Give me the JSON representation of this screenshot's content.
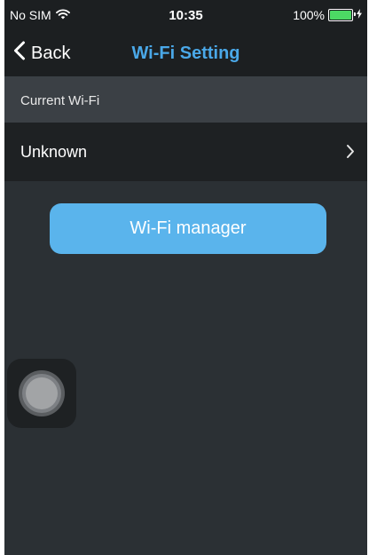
{
  "status_bar": {
    "carrier": "No SIM",
    "time": "10:35",
    "battery_percent": "100%",
    "battery_level": 1.0,
    "battery_color": "#4cd964"
  },
  "nav_bar": {
    "back_label": "Back",
    "title": "Wi-Fi Setting",
    "title_color": "#4aa8e8"
  },
  "section": {
    "header": "Current Wi-Fi"
  },
  "wifi_row": {
    "value": "Unknown",
    "icon": "chevron-right-icon"
  },
  "actions": {
    "wifi_manager_label": "Wi-Fi manager",
    "button_color": "#5ab4ec"
  },
  "icons": {
    "wifi": "wifi-icon",
    "back": "chevron-left-icon",
    "battery": "battery-icon",
    "charging": "lightning-icon",
    "assistive_touch": "assistive-touch-icon"
  }
}
